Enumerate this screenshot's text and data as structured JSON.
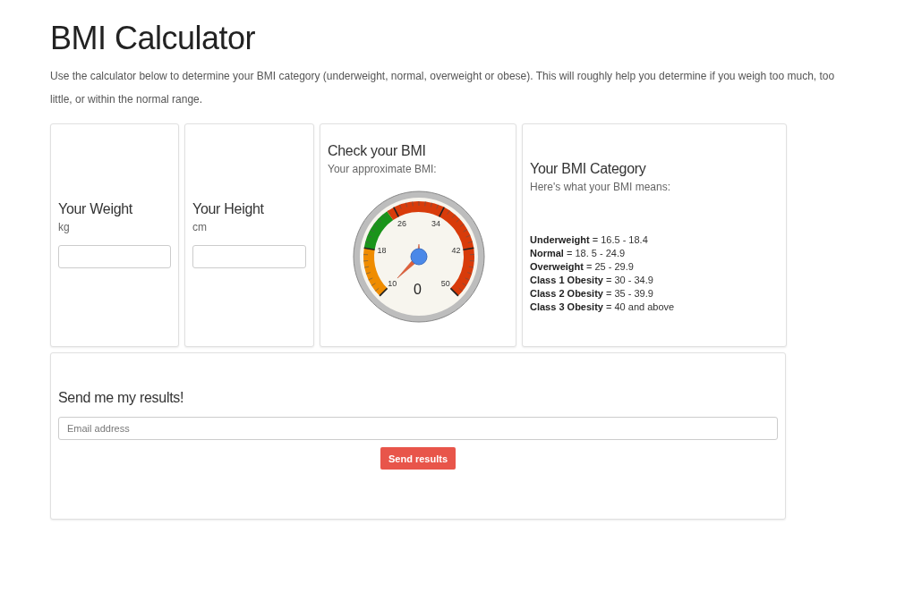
{
  "page": {
    "title": "BMI Calculator",
    "intro": "Use the calculator below to determine your BMI category (underweight, normal, overweight or obese). This will roughly help you determine if you weigh too much, too little, or within the normal range."
  },
  "inputs": [
    {
      "title": "Your Weight",
      "unit": "kg"
    },
    {
      "title": "Your Height",
      "unit": "cm"
    }
  ],
  "gauge": {
    "title": "Check your BMI",
    "subtitle": "Your approximate BMI:",
    "scale_labels": [
      "10",
      "18",
      "26",
      "34",
      "42",
      "50"
    ],
    "reading": "0"
  },
  "category": {
    "title": "Your BMI Category",
    "subtitle": "Here's what your BMI means:",
    "lines": [
      "**Underweight** = 16.5 - 18.4",
      "**Normal** = 18. 5 - 24.9",
      "**Overweight** = 25 - 29.9",
      "**Class 1 Obesity** = 30 - 34.9",
      "**Class 2 Obesity** = 35 - 39.9",
      "**Class 3 Obesity** = 40 and above"
    ]
  },
  "send": {
    "title": "Send me my results!",
    "placeholder": "Email address",
    "button": "Send results"
  }
}
